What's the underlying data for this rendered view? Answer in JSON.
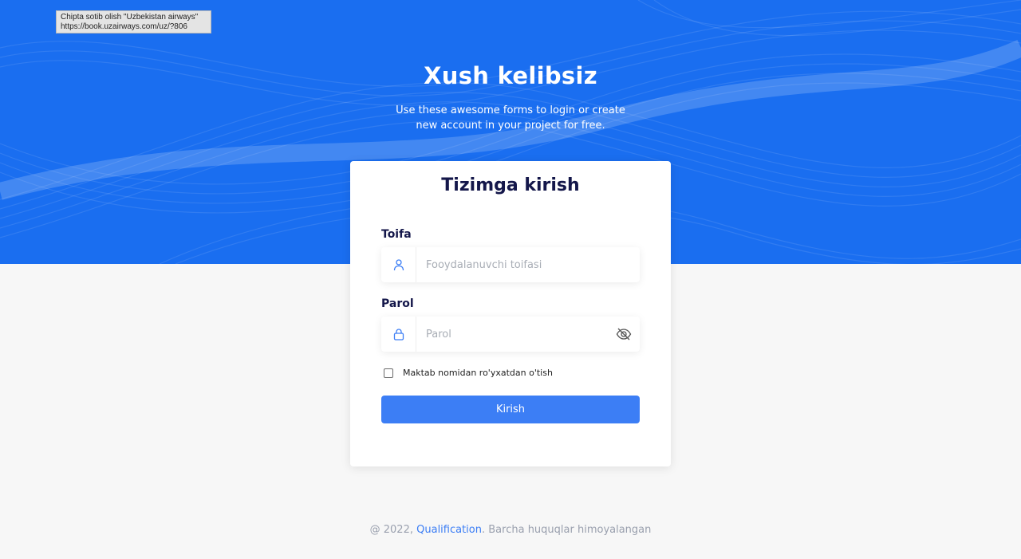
{
  "tooltip": {
    "line1": "Chipta sotib olish \"Uzbekistan airways\"",
    "line2": "https://book.uzairways.com/uz/?806"
  },
  "hero": {
    "title": "Xush kelibsiz",
    "subtitle": "Use these awesome forms to login or create new account in your project for free."
  },
  "login": {
    "title": "Tizimga kirish",
    "category_label": "Toifa",
    "category_placeholder": "Fooydalanuvchi toifasi",
    "category_icon": "user-icon",
    "password_label": "Parol",
    "password_placeholder": "Parol",
    "password_icon": "lock-icon",
    "password_toggle_icon": "eye-off-icon",
    "checkbox_label": "Maktab nomidan ro'yxatdan o'tish",
    "checkbox_checked": false,
    "submit_label": "Kirish"
  },
  "footer": {
    "prefix": "@ 2022,",
    "link": "Qualification",
    "suffix": ". Barcha huquqlar himoyalangan"
  },
  "colors": {
    "hero_bg": "#1a6ef0",
    "accent": "#3c7ef5",
    "title_text": "#14174a",
    "page_bg": "#f7f7f7"
  }
}
